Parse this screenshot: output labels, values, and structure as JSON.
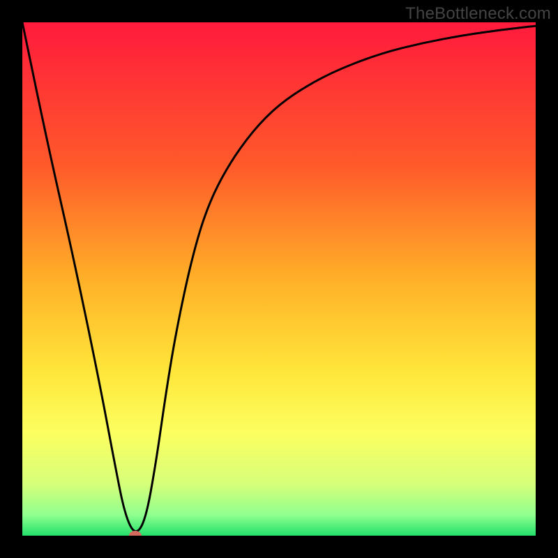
{
  "watermark": "TheBottleneck.com",
  "chart_data": {
    "type": "line",
    "title": "",
    "xlabel": "",
    "ylabel": "",
    "xlim": [
      0,
      100
    ],
    "ylim": [
      0,
      100
    ],
    "gradient_stops": [
      {
        "offset": 0,
        "color": "#ff1a3c"
      },
      {
        "offset": 28,
        "color": "#ff5a2a"
      },
      {
        "offset": 50,
        "color": "#ffb028"
      },
      {
        "offset": 68,
        "color": "#ffe63a"
      },
      {
        "offset": 80,
        "color": "#fcff60"
      },
      {
        "offset": 90,
        "color": "#d6ff7a"
      },
      {
        "offset": 96,
        "color": "#8fff8f"
      },
      {
        "offset": 100,
        "color": "#22e06a"
      }
    ],
    "series": [
      {
        "name": "curve",
        "x": [
          0,
          5,
          10,
          15,
          18,
          20,
          22,
          24,
          26,
          28,
          30,
          33,
          36,
          40,
          45,
          50,
          56,
          62,
          70,
          78,
          86,
          93,
          100
        ],
        "y": [
          100,
          76,
          54,
          30,
          14,
          4,
          0,
          3,
          14,
          28,
          40,
          54,
          64,
          72,
          79,
          84,
          88,
          91,
          94,
          96,
          97.5,
          98.5,
          99.3
        ]
      }
    ],
    "marker": {
      "x": 22,
      "y": 0,
      "color": "#d46a5e"
    }
  }
}
